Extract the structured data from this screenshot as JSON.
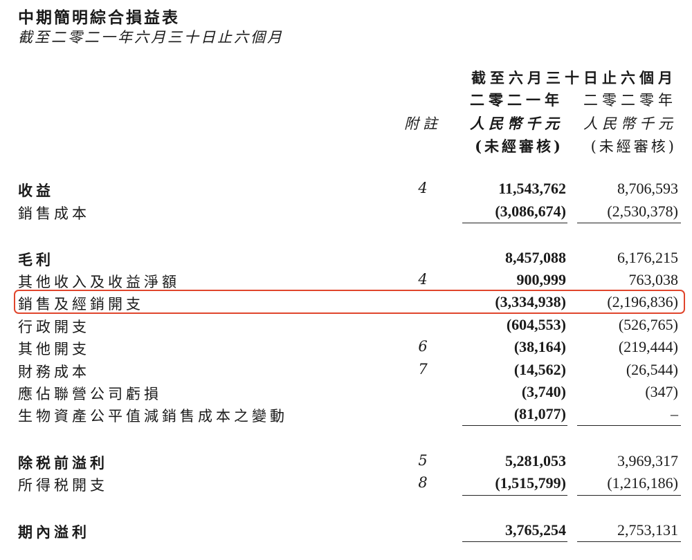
{
  "title": "中期簡明綜合損益表",
  "subtitle": "截至二零二一年六月三十日止六個月",
  "header": {
    "period": "截至六月三十日止六個月",
    "year_2021": "二零二一年",
    "year_2020": "二零二零年",
    "notes_label": "附註",
    "unit_2021": "人民幣千元",
    "unit_2020": "人民幣千元",
    "audit_2021": "(未經審核)",
    "audit_2020": "(未經審核)"
  },
  "rows": [
    {
      "label": "收益",
      "note": "4",
      "y2021": "11,543,762",
      "y2020": "8,706,593",
      "bold": true
    },
    {
      "label": "銷售成本",
      "note": "",
      "y2021": "(3,086,674)",
      "y2020": "(2,530,378)"
    },
    {
      "label": "毛利",
      "note": "",
      "y2021": "8,457,088",
      "y2020": "6,176,215",
      "bold": true
    },
    {
      "label": "其他收入及收益淨額",
      "note": "4",
      "y2021": "900,999",
      "y2020": "763,038"
    },
    {
      "label": "銷售及經銷開支",
      "note": "",
      "y2021": "(3,334,938)",
      "y2020": "(2,196,836)"
    },
    {
      "label": "行政開支",
      "note": "",
      "y2021": "(604,553)",
      "y2020": "(526,765)"
    },
    {
      "label": "其他開支",
      "note": "6",
      "y2021": "(38,164)",
      "y2020": "(219,444)"
    },
    {
      "label": "財務成本",
      "note": "7",
      "y2021": "(14,562)",
      "y2020": "(26,544)"
    },
    {
      "label": "應佔聯營公司虧損",
      "note": "",
      "y2021": "(3,740)",
      "y2020": "(347)"
    },
    {
      "label": "生物資產公平值減銷售成本之變動",
      "note": "",
      "y2021": "(81,077)",
      "y2020": "–"
    },
    {
      "label": "除税前溢利",
      "note": "5",
      "y2021": "5,281,053",
      "y2020": "3,969,317",
      "bold": true
    },
    {
      "label": "所得税開支",
      "note": "8",
      "y2021": "(1,515,799)",
      "y2020": "(1,216,186)"
    },
    {
      "label": "期內溢利",
      "note": "",
      "y2021": "3,765,254",
      "y2020": "2,753,131",
      "bold": true
    }
  ],
  "highlight_color": "#e0452c"
}
